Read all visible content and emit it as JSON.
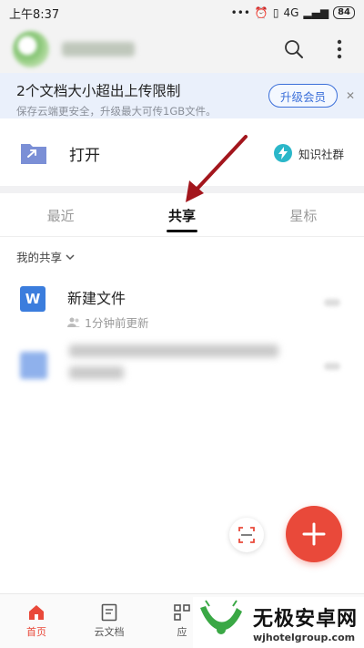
{
  "status_bar": {
    "time": "上午8:37",
    "signal": "4G",
    "battery": "84"
  },
  "banner": {
    "title": "2个文档大小超出上传限制",
    "subtitle": "保存云端更安全，升级最大可传1GB文件。",
    "upgrade_label": "升级会员",
    "close_glyph": "✕"
  },
  "open_row": {
    "label": "打开",
    "community_label": "知识社群"
  },
  "tabs": [
    {
      "label": "最近",
      "active": false
    },
    {
      "label": "共享",
      "active": true
    },
    {
      "label": "星标",
      "active": false
    }
  ],
  "share_filter": {
    "label": "我的共享",
    "chevron": "⌄"
  },
  "files": [
    {
      "icon_letter": "W",
      "name": "新建文件",
      "meta": "1分钟前更新",
      "icon_color": "#3b7ddd"
    }
  ],
  "bottom_nav": [
    {
      "label": "首页",
      "active": true
    },
    {
      "label": "云文档",
      "active": false
    },
    {
      "label": "应",
      "active": false
    }
  ],
  "watermark": {
    "title": "无极安卓网",
    "url": "wjhotelgroup.com"
  },
  "colors": {
    "accent": "#e9493a",
    "brand_blue": "#3b6fd9",
    "arrow": "#a3161d"
  }
}
